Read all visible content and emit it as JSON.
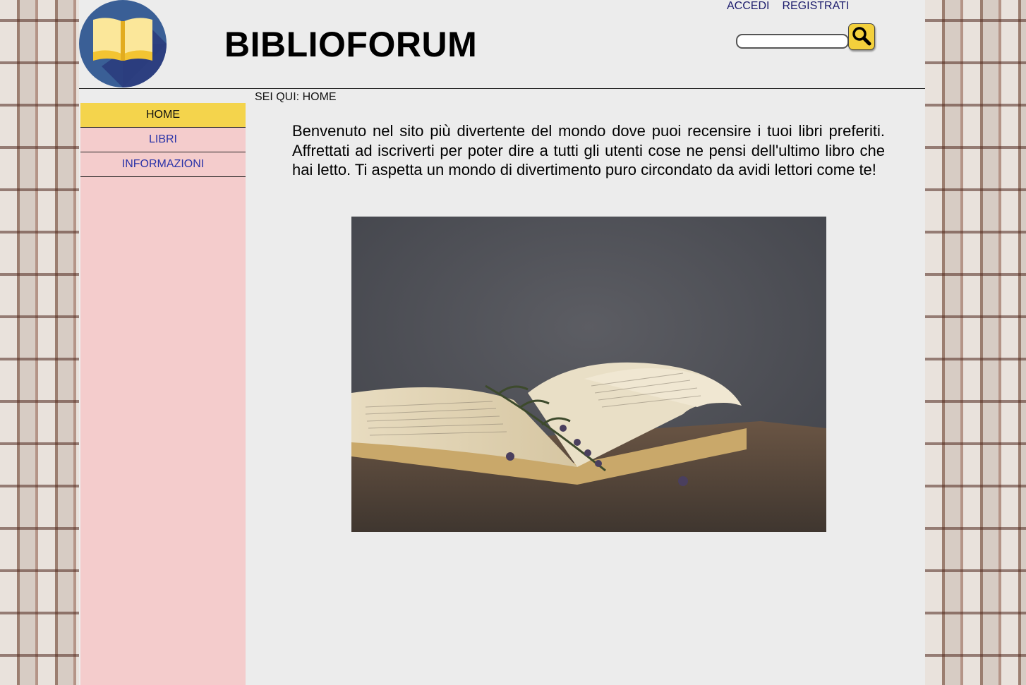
{
  "header": {
    "site_title": "BIBLIOFORUM",
    "logo_icon": "open-book-icon",
    "links": {
      "login": "ACCEDI",
      "register": "REGISTRATI"
    },
    "search": {
      "value": "",
      "placeholder": "",
      "button_icon": "search-icon"
    }
  },
  "nav": {
    "items": [
      {
        "label": "HOME",
        "active": true
      },
      {
        "label": "LIBRI",
        "active": false
      },
      {
        "label": "INFORMAZIONI",
        "active": false
      }
    ]
  },
  "breadcrumb": {
    "text": "SEI QUI: HOME"
  },
  "main": {
    "intro_text": "Benvenuto nel sito più divertente del mondo dove puoi recensire i tuoi libri preferiti. Affrettati ad iscriverti per poter dire a tutti gli utenti cose ne pensi dell'ultimo libro che hai letto. Ti aspetta un mondo di divertimento puro circondato da avidi lettori come te!",
    "image_subject": "open-book-with-lavender-photo"
  },
  "colors": {
    "page_bg": "#ececec",
    "sidebar_bg": "#f4cccc",
    "nav_active_bg": "#f4d44c",
    "nav_link": "#2a33a8",
    "auth_link": "#1a1a6b",
    "search_button": "#f3d03c"
  }
}
